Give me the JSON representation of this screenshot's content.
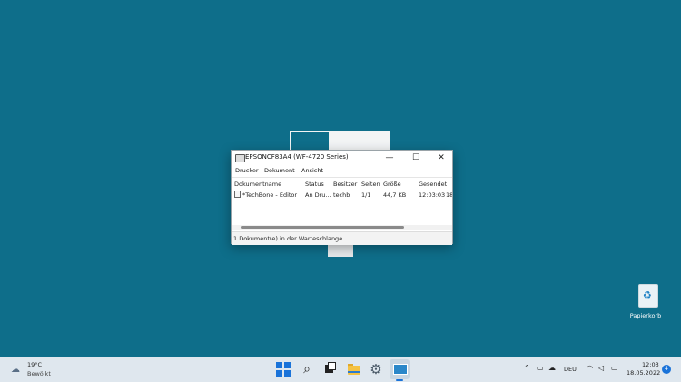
{
  "window": {
    "title": "EPSONCF83A4 (WF-4720 Series)",
    "minimize": "—",
    "maximize": "☐",
    "close": "✕",
    "menu": [
      "Drucker",
      "Dokument",
      "Ansicht"
    ],
    "columns": [
      "Dokumentname",
      "Status",
      "Besitzer",
      "Seiten",
      "Größe",
      "Gesendet"
    ],
    "rows": [
      {
        "name": "*TechBone - Editor",
        "status": "An Dru...",
        "owner": "techb",
        "pages": "1/1",
        "size": "44,7 KB",
        "sent": "12:03:03",
        "sent_more": "18"
      }
    ],
    "status_text": "1 Dokument(e) in der Warteschlange"
  },
  "desktop": {
    "recycle_bin_label": "Papierkorb"
  },
  "taskbar": {
    "weather": {
      "temp": "19°C",
      "condition": "Bewölkt"
    },
    "search_icon": "⌕",
    "settings_icon": "⚙",
    "tray": {
      "chevron": "⌃",
      "language": "DEU",
      "time": "12:03",
      "date": "18.05.2022",
      "notifications": "4"
    }
  },
  "colors": {
    "desktop": "#0e6e8a",
    "taskbar": "#dfe7ee",
    "accent": "#1a73d9"
  }
}
